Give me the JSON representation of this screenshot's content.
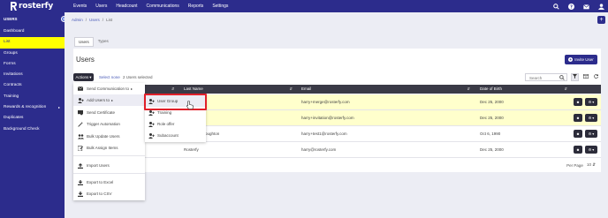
{
  "app": {
    "brand": "rosterfy"
  },
  "topnav": {
    "items": [
      "Events",
      "Users",
      "Headcount",
      "Communications",
      "Reports",
      "Settings"
    ]
  },
  "sidebar": {
    "header": "USERS",
    "items": [
      {
        "label": "Dashboard"
      },
      {
        "label": "List",
        "active": true
      },
      {
        "label": "Groups"
      },
      {
        "label": "Forms"
      },
      {
        "label": "Invitations"
      },
      {
        "label": "Contracts"
      },
      {
        "label": "Training"
      },
      {
        "label": "Rewards & recognition",
        "has_caret": true
      },
      {
        "label": "Duplicates"
      },
      {
        "label": "Background Check"
      }
    ]
  },
  "breadcrumb": {
    "items": [
      "Admin",
      "Users",
      "List"
    ],
    "sep": "/"
  },
  "tabs": [
    {
      "label": "Users",
      "active": true
    },
    {
      "label": "Types"
    }
  ],
  "page": {
    "title": "Users",
    "invite_label": "Invite User"
  },
  "toolbar": {
    "actions_label": "Actions",
    "select_none": "Select none",
    "selected_count": "2 Users selected",
    "search_placeholder": "Search"
  },
  "table": {
    "columns": [
      "Last Name",
      "Email",
      "Date of Birth"
    ],
    "rows": [
      {
        "first_visible": "",
        "last_name": "",
        "email": "harry+merge@rosterfy.com",
        "dob": "Dec 25, 2000",
        "highlight": true
      },
      {
        "first_visible": "",
        "last_name": "",
        "email": "harry+invitation@rosterfy.com",
        "dob": "Dec 25, 2000",
        "highlight": true
      },
      {
        "first_visible": "",
        "last_name": "oughton",
        "email": "harry+test1@rosterfy.com",
        "dob": "Oct 6, 1990",
        "highlight": false
      },
      {
        "first_visible": "",
        "last_name": "Rosterfy",
        "email": "harry@rosterfy.com",
        "dob": "Dec 25, 2000",
        "highlight": false
      }
    ]
  },
  "pager": {
    "label": "Per Page",
    "value": "10"
  },
  "actions_menu": {
    "items": [
      {
        "label": "Send Communication to",
        "has_arrow": true,
        "icon": "envelope-icon"
      },
      {
        "label": "Add Users to",
        "has_arrow": true,
        "icon": "user-plus-icon",
        "hover": true
      },
      {
        "label": "Send Certificate",
        "icon": "certificate-icon"
      },
      {
        "label": "Trigger Automation",
        "icon": "magic-icon"
      },
      {
        "label": "Bulk Update Users",
        "icon": "users-icon"
      },
      {
        "label": "Bulk Assign Items",
        "icon": "edit-icon"
      },
      {
        "label": "Import Users",
        "icon": "upload-icon"
      },
      {
        "label": "Export to Excel",
        "icon": "download-icon"
      },
      {
        "label": "Export to CSV",
        "icon": "download-icon"
      }
    ]
  },
  "add_users_submenu": {
    "items": [
      {
        "label": "User Group",
        "hover": true
      },
      {
        "label": "Training"
      },
      {
        "label": "Role offer"
      },
      {
        "label": "Subaccount"
      }
    ]
  },
  "colors": {
    "brand": "#2c2c8c",
    "active_item": "#ffff00",
    "row_highlight": "#ffffcc",
    "callout": "#e0202a"
  }
}
